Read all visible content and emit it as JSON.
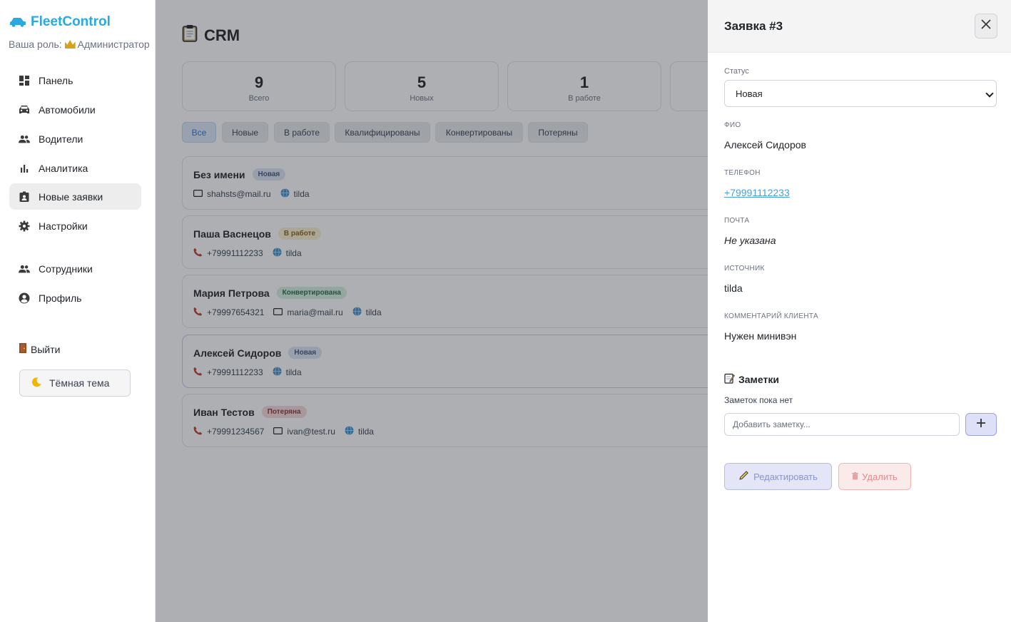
{
  "app": {
    "brand": "FleetControl",
    "role_prefix": "Ваша роль:",
    "role_name": "Администратор"
  },
  "sidebar": {
    "items": [
      {
        "label": "Панель",
        "icon": "dashboard-icon"
      },
      {
        "label": "Автомобили",
        "icon": "car-icon"
      },
      {
        "label": "Водители",
        "icon": "people-icon"
      },
      {
        "label": "Аналитика",
        "icon": "bar-chart-icon"
      },
      {
        "label": "Новые заявки",
        "icon": "contact-card-icon",
        "active": true
      },
      {
        "label": "Настройки",
        "icon": "gear-icon"
      },
      {
        "label": "Сотрудники",
        "icon": "people-icon"
      },
      {
        "label": "Профиль",
        "icon": "account-circle-icon"
      }
    ],
    "logout_label": "Выйти",
    "theme_label": "Тёмная тема"
  },
  "main": {
    "title": "CRM",
    "stats": [
      {
        "value": "9",
        "label": "Всего"
      },
      {
        "value": "5",
        "label": "Новых"
      },
      {
        "value": "1",
        "label": "В работе"
      }
    ],
    "filters": [
      "Все",
      "Новые",
      "В работе",
      "Квалифицированы",
      "Конвертированы",
      "Потеряны"
    ],
    "active_filter": "Все",
    "leads": [
      {
        "name": "Без имени",
        "status": "Новая",
        "phone": "",
        "email": "shahsts@mail.ru",
        "source": "tilda"
      },
      {
        "name": "Паша Васнецов",
        "status": "В работе",
        "phone": "+79991112233",
        "email": "",
        "source": "tilda"
      },
      {
        "name": "Мария Петрова",
        "status": "Конвертирована",
        "phone": "+79997654321",
        "email": "maria@mail.ru",
        "source": "tilda"
      },
      {
        "name": "Алексей Сидоров",
        "status": "Новая",
        "phone": "+79991112233",
        "email": "",
        "source": "tilda"
      },
      {
        "name": "Иван Тестов",
        "status": "Потеряна",
        "phone": "+79991234567",
        "email": "ivan@test.ru",
        "source": "tilda"
      }
    ]
  },
  "drawer": {
    "title": "Заявка #3",
    "status_label": "Статус",
    "status_value": "Новая",
    "name_label": "ФИО",
    "name_value": "Алексей Сидоров",
    "phone_label": "Телефон",
    "phone_value": "+79991112233",
    "email_label": "Почта",
    "email_value": "Не указана",
    "source_label": "Источник",
    "source_value": "tilda",
    "comment_label": "Комментарий клиента",
    "comment_value": "Нужен минивэн",
    "notes_title": "Заметки",
    "notes_empty": "Заметок пока нет",
    "note_placeholder": "Добавить заметку...",
    "edit_label": "Редактировать",
    "delete_label": "Удалить"
  },
  "colors": {
    "brand": "#29a9e0",
    "link": "#4a9fd8",
    "overlay": "#282c34"
  }
}
